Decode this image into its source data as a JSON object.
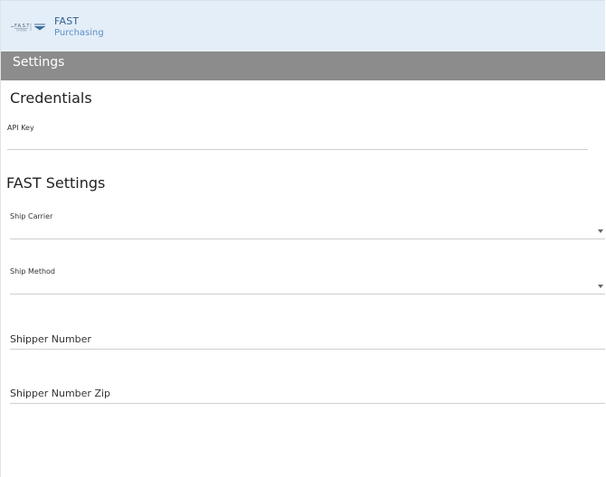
{
  "app": {
    "brand_title": "FAST",
    "brand_subtitle": "Purchasing"
  },
  "page": {
    "title": "Settings"
  },
  "credentials": {
    "section_title": "Credentials",
    "api_key": {
      "label": "API Key",
      "value": ""
    }
  },
  "fast_settings": {
    "section_title": "FAST Settings",
    "ship_carrier": {
      "label": "Ship Carrier",
      "value": ""
    },
    "ship_method": {
      "label": "Ship Method",
      "value": ""
    },
    "shipper_number": {
      "placeholder": "Shipper Number",
      "value": ""
    },
    "shipper_number_zip": {
      "placeholder": "Shipper Number Zip",
      "value": ""
    }
  },
  "icons": {
    "logo": "fast-systems-logo",
    "dropdown": "chevron-down-icon"
  },
  "colors": {
    "header_bg": "#e4eef8",
    "titlebar_bg": "#8c8c8c",
    "brand_text": "#2f5f8f",
    "brand_sub_text": "#5a8fc4"
  }
}
